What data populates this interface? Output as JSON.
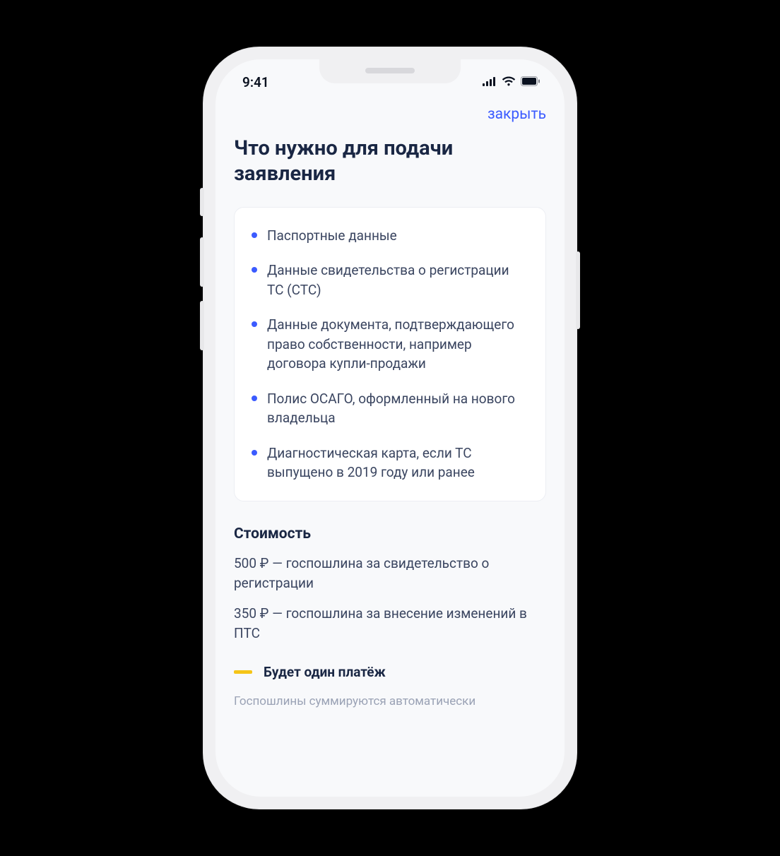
{
  "status": {
    "time": "9:41"
  },
  "nav": {
    "close": "закрыть"
  },
  "page": {
    "title": "Что нужно для подачи заявления"
  },
  "requirements": {
    "items": [
      "Паспортные данные",
      "Данные свидетельства о регистрации ТС (СТС)",
      "Данные документа, подтверждающего право собственности, например договора купли-продажи",
      "Полис ОСАГО, оформленный на нового владельца",
      "Диагностическая карта, если ТС выпущено в 2019 году или ранее"
    ]
  },
  "cost": {
    "heading": "Стоимость",
    "lines": [
      "500 ₽ — госпошлина за свидетельство о регистрации",
      "350 ₽ — госпошлина за внесение изменений в ПТС"
    ]
  },
  "payment": {
    "single": "Будет один платёж",
    "note": "Госпошлины суммируются автоматически"
  }
}
